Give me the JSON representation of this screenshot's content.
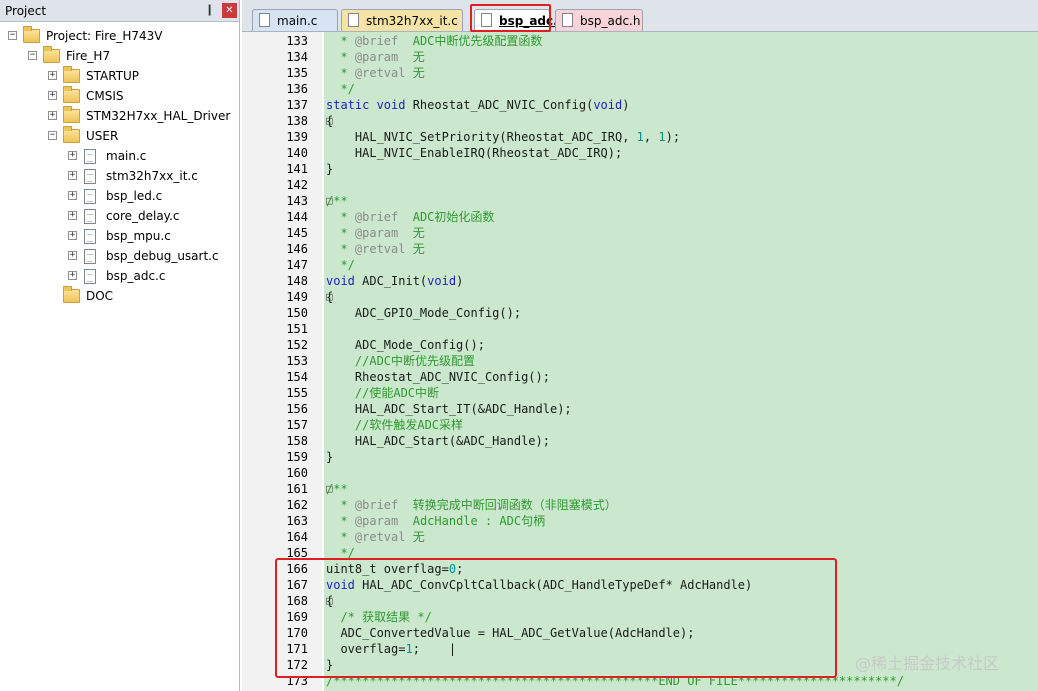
{
  "project_panel": {
    "title": "Project",
    "pin_glyph": "❙",
    "close_glyph": "✕",
    "tree": [
      {
        "label": "Project: Fire_H743V",
        "level": 0,
        "expander": "−",
        "icon": "project-icon"
      },
      {
        "label": "Fire_H7",
        "level": 1,
        "expander": "−",
        "icon": "target-folder-icon"
      },
      {
        "label": "STARTUP",
        "level": 2,
        "expander": "+",
        "icon": "folder-icon"
      },
      {
        "label": "CMSIS",
        "level": 2,
        "expander": "+",
        "icon": "folder-icon"
      },
      {
        "label": "STM32H7xx_HAL_Driver",
        "level": 2,
        "expander": "+",
        "icon": "folder-icon"
      },
      {
        "label": "USER",
        "level": 2,
        "expander": "−",
        "icon": "folder-icon"
      },
      {
        "label": "main.c",
        "level": 3,
        "expander": "+",
        "icon": "file-icon"
      },
      {
        "label": "stm32h7xx_it.c",
        "level": 3,
        "expander": "+",
        "icon": "file-icon"
      },
      {
        "label": "bsp_led.c",
        "level": 3,
        "expander": "+",
        "icon": "file-icon"
      },
      {
        "label": "core_delay.c",
        "level": 3,
        "expander": "+",
        "icon": "file-icon"
      },
      {
        "label": "bsp_mpu.c",
        "level": 3,
        "expander": "+",
        "icon": "file-icon"
      },
      {
        "label": "bsp_debug_usart.c",
        "level": 3,
        "expander": "+",
        "icon": "file-icon"
      },
      {
        "label": "bsp_adc.c",
        "level": 3,
        "expander": "+",
        "icon": "file-icon"
      },
      {
        "label": "DOC",
        "level": 2,
        "expander": "",
        "icon": "folder-icon"
      }
    ]
  },
  "tabs": [
    {
      "label": "main.c",
      "color": "#d6e4f3",
      "active": false
    },
    {
      "label": "stm32h7xx_it.c",
      "color": "#f5e3a6",
      "active": false
    },
    {
      "label": "bsp_adc.c",
      "color": "#ffffff",
      "active": true
    },
    {
      "label": "bsp_adc.h",
      "color": "#f8d3d8",
      "active": false
    }
  ],
  "editor": {
    "lines": [
      {
        "n": "133",
        "fold": "",
        "segs": [
          [
            "cm",
            "  * "
          ],
          [
            "dc",
            "@brief"
          ],
          [
            "cm",
            "  ADC中断优先级配置函数"
          ]
        ]
      },
      {
        "n": "134",
        "fold": "",
        "segs": [
          [
            "cm",
            "  * "
          ],
          [
            "dc",
            "@param"
          ],
          [
            "cm",
            "  无"
          ]
        ]
      },
      {
        "n": "135",
        "fold": "",
        "segs": [
          [
            "cm",
            "  * "
          ],
          [
            "dc",
            "@retval"
          ],
          [
            "cm",
            " 无"
          ]
        ]
      },
      {
        "n": "136",
        "fold": "",
        "segs": [
          [
            "cm",
            "  */"
          ]
        ]
      },
      {
        "n": "137",
        "fold": "",
        "segs": [
          [
            "kw",
            "static void"
          ],
          [
            "",
            " Rheostat_ADC_NVIC_Config("
          ],
          [
            "kw",
            "void"
          ],
          [
            "",
            ")"
          ]
        ]
      },
      {
        "n": "138",
        "fold": "□",
        "segs": [
          [
            "",
            "{"
          ]
        ]
      },
      {
        "n": "139",
        "fold": "",
        "segs": [
          [
            "",
            "    HAL_NVIC_SetPriority(Rheostat_ADC_IRQ, "
          ],
          [
            "num",
            "1"
          ],
          [
            "",
            ", "
          ],
          [
            "num",
            "1"
          ],
          [
            "",
            ");"
          ]
        ]
      },
      {
        "n": "140",
        "fold": "",
        "segs": [
          [
            "",
            "    HAL_NVIC_EnableIRQ(Rheostat_ADC_IRQ);"
          ]
        ]
      },
      {
        "n": "141",
        "fold": "",
        "segs": [
          [
            "",
            "}"
          ]
        ]
      },
      {
        "n": "142",
        "fold": "",
        "segs": []
      },
      {
        "n": "143",
        "fold": "□",
        "segs": [
          [
            "cm",
            "/**"
          ]
        ]
      },
      {
        "n": "144",
        "fold": "",
        "segs": [
          [
            "cm",
            "  * "
          ],
          [
            "dc",
            "@brief"
          ],
          [
            "cm",
            "  ADC初始化函数"
          ]
        ]
      },
      {
        "n": "145",
        "fold": "",
        "segs": [
          [
            "cm",
            "  * "
          ],
          [
            "dc",
            "@param"
          ],
          [
            "cm",
            "  无"
          ]
        ]
      },
      {
        "n": "146",
        "fold": "",
        "segs": [
          [
            "cm",
            "  * "
          ],
          [
            "dc",
            "@retval"
          ],
          [
            "cm",
            " 无"
          ]
        ]
      },
      {
        "n": "147",
        "fold": "",
        "segs": [
          [
            "cm",
            "  */"
          ]
        ]
      },
      {
        "n": "148",
        "fold": "",
        "segs": [
          [
            "kw",
            "void"
          ],
          [
            "",
            " ADC_Init("
          ],
          [
            "kw",
            "void"
          ],
          [
            "",
            ")"
          ]
        ]
      },
      {
        "n": "149",
        "fold": "□",
        "segs": [
          [
            "",
            "{"
          ]
        ]
      },
      {
        "n": "150",
        "fold": "",
        "segs": [
          [
            "",
            "    ADC_GPIO_Mode_Config();"
          ]
        ]
      },
      {
        "n": "151",
        "fold": "",
        "segs": []
      },
      {
        "n": "152",
        "fold": "",
        "segs": [
          [
            "",
            "    ADC_Mode_Config();"
          ]
        ]
      },
      {
        "n": "153",
        "fold": "",
        "segs": [
          [
            "cm",
            "    //ADC中断优先级配置"
          ]
        ]
      },
      {
        "n": "154",
        "fold": "",
        "segs": [
          [
            "",
            "    Rheostat_ADC_NVIC_Config();"
          ]
        ]
      },
      {
        "n": "155",
        "fold": "",
        "segs": [
          [
            "cm",
            "    //使能ADC中断"
          ]
        ]
      },
      {
        "n": "156",
        "fold": "",
        "segs": [
          [
            "",
            "    HAL_ADC_Start_IT(&ADC_Handle);"
          ]
        ]
      },
      {
        "n": "157",
        "fold": "",
        "segs": [
          [
            "cm",
            "    //软件触发ADC采样"
          ]
        ]
      },
      {
        "n": "158",
        "fold": "",
        "segs": [
          [
            "",
            "    HAL_ADC_Start(&ADC_Handle);"
          ]
        ]
      },
      {
        "n": "159",
        "fold": "",
        "segs": [
          [
            "",
            "}"
          ]
        ]
      },
      {
        "n": "160",
        "fold": "",
        "segs": []
      },
      {
        "n": "161",
        "fold": "□",
        "segs": [
          [
            "cm",
            "/**"
          ]
        ]
      },
      {
        "n": "162",
        "fold": "",
        "segs": [
          [
            "cm",
            "  * "
          ],
          [
            "dc",
            "@brief"
          ],
          [
            "cm",
            "  转换完成中断回调函数（非阻塞模式）"
          ]
        ]
      },
      {
        "n": "163",
        "fold": "",
        "segs": [
          [
            "cm",
            "  * "
          ],
          [
            "dc",
            "@param"
          ],
          [
            "cm",
            "  AdcHandle : ADC句柄"
          ]
        ]
      },
      {
        "n": "164",
        "fold": "",
        "segs": [
          [
            "cm",
            "  * "
          ],
          [
            "dc",
            "@retval"
          ],
          [
            "cm",
            " 无"
          ]
        ]
      },
      {
        "n": "165",
        "fold": "",
        "segs": [
          [
            "cm",
            "  */"
          ]
        ]
      },
      {
        "n": "166",
        "fold": "",
        "segs": [
          [
            "",
            "uint8_t overflag="
          ],
          [
            "num",
            "0"
          ],
          [
            "",
            ";"
          ]
        ]
      },
      {
        "n": "167",
        "fold": "",
        "segs": [
          [
            "kw",
            "void"
          ],
          [
            "",
            " HAL_ADC_ConvCpltCallback(ADC_HandleTypeDef* AdcHandle)"
          ]
        ]
      },
      {
        "n": "168",
        "fold": "□",
        "segs": [
          [
            "",
            "{"
          ]
        ]
      },
      {
        "n": "169",
        "fold": "",
        "segs": [
          [
            "cm",
            "  /* 获取结果 */"
          ]
        ]
      },
      {
        "n": "170",
        "fold": "",
        "segs": [
          [
            "",
            "  ADC_ConvertedValue = HAL_ADC_GetValue(AdcHandle);"
          ]
        ]
      },
      {
        "n": "171",
        "fold": "",
        "segs": [
          [
            "",
            "  overflag="
          ],
          [
            "num",
            "1"
          ],
          [
            "",
            ";    |"
          ]
        ]
      },
      {
        "n": "172",
        "fold": "",
        "segs": [
          [
            "",
            "}"
          ]
        ]
      },
      {
        "n": "173",
        "fold": "",
        "segs": [
          [
            "cm",
            "/*********************************************END OF FILE**********************/"
          ]
        ]
      }
    ]
  },
  "watermark": "@稀土掘金技术社区"
}
